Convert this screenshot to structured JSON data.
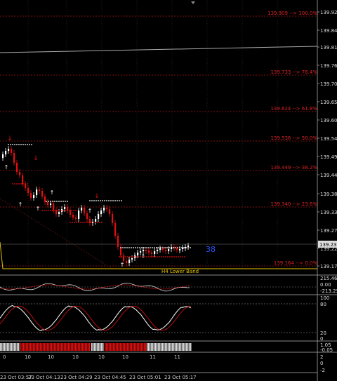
{
  "price_axis": {
    "ticks": [
      "139.920",
      "139.845",
      "139.815",
      "139.760",
      "139.705",
      "139.650",
      "139.600",
      "139.545",
      "139.490",
      "139.440",
      "139.385",
      "139.330",
      "139.275",
      "139.220",
      "139.170"
    ],
    "current_price": "139.233"
  },
  "fib_levels": [
    {
      "text": "139.909 --> 100.0%"
    },
    {
      "text": "139.733 --> 76.4%"
    },
    {
      "text": "139.624 --> 61.8%"
    },
    {
      "text": "139.536 --> 50.0%"
    },
    {
      "text": "139.449 --> 38.2%"
    },
    {
      "text": "139.340 --> 23.6%"
    },
    {
      "text": "139.164 --> 0.0%"
    }
  ],
  "band_label": "H4 Lower Band",
  "countdown": "38",
  "sub1": {
    "top": "215.463",
    "mid": "0.00",
    "bot": "-213.25"
  },
  "sub2": {
    "top": "100",
    "mid": "80",
    "low": "20",
    "bot": "0"
  },
  "sub3": {
    "top": "1.05",
    "bot": "-0.05"
  },
  "sub4": {
    "top": "2",
    "mid": "0",
    "bot": "-2"
  },
  "time_axis": {
    "labels": [
      "23 Oct 03:57",
      "23 Oct 04:13",
      "23 Oct 04:29",
      "23 Oct 04:45",
      "23 Oct 05:01",
      "23 Oct 05:17"
    ],
    "minor": [
      "0",
      "10",
      "10",
      "10",
      "10",
      "10",
      "11",
      "11"
    ]
  },
  "colors": {
    "bg": "#000000",
    "fib": "#dd2222",
    "band": "#e8c400",
    "bull": "#ffffff",
    "bear": "#e01010",
    "countdown": "#2a55ff"
  }
}
